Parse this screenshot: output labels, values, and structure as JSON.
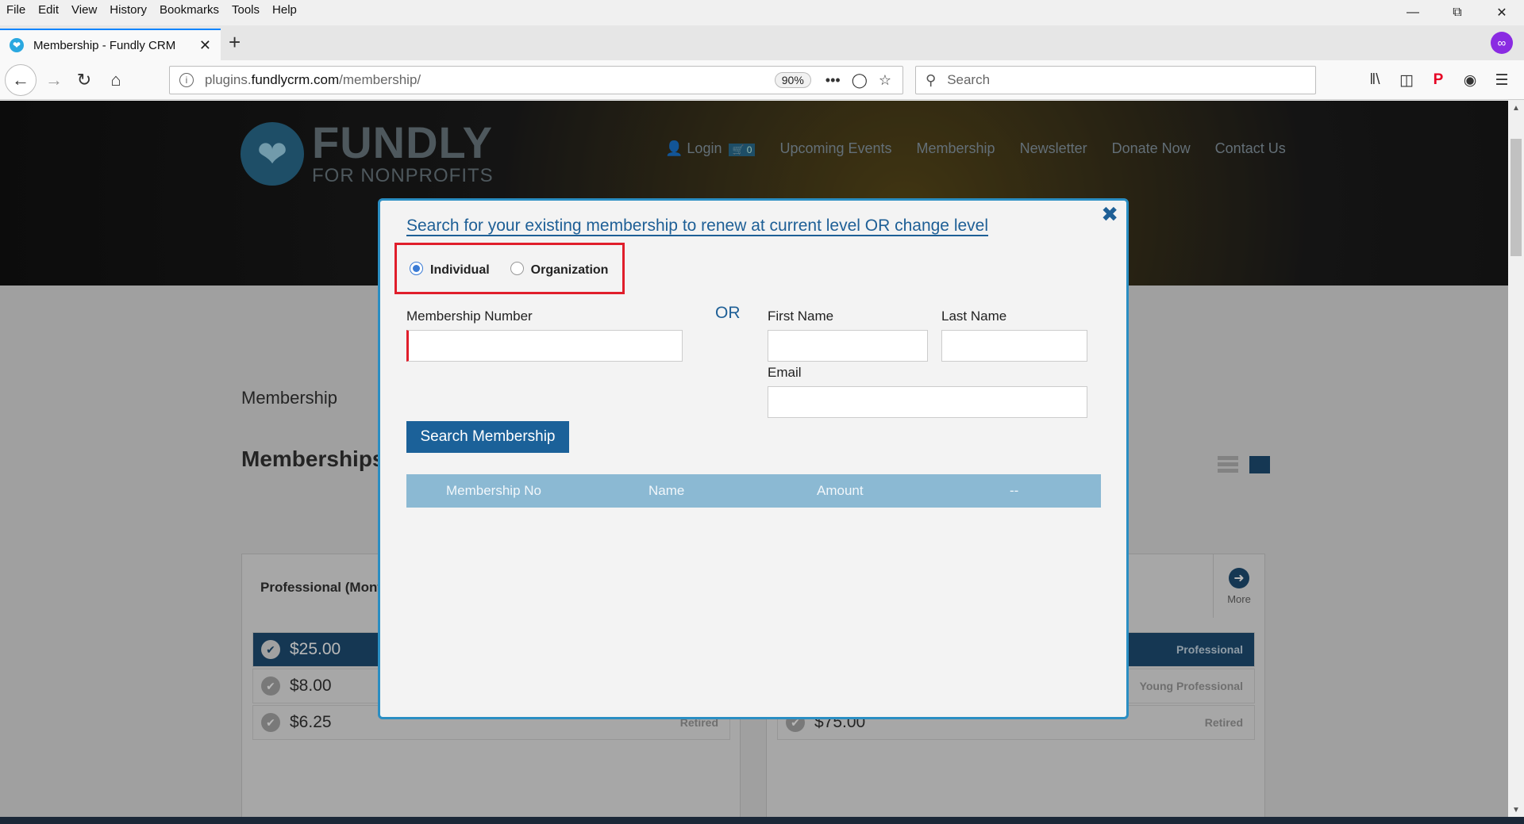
{
  "browser": {
    "menu": [
      "File",
      "Edit",
      "View",
      "History",
      "Bookmarks",
      "Tools",
      "Help"
    ],
    "tab_title": "Membership - Fundly CRM",
    "url_domain": "plugins.fundlycrm.com",
    "url_prefix": "plugins.",
    "url_host": "fundlycrm.com",
    "url_path": "/membership/",
    "zoom": "90%",
    "search_placeholder": "Search"
  },
  "site": {
    "brand": "FUNDLY",
    "tagline": "FOR NONPROFITS",
    "nav": {
      "login": "Login",
      "cart_count": "0",
      "items": [
        "Upcoming Events",
        "Membership",
        "Newsletter",
        "Donate Now",
        "Contact Us"
      ]
    },
    "page_heading": "Membership",
    "section_heading": "Memberships",
    "cards": {
      "left_title": "Professional (Mont",
      "right_more": "More",
      "left_rows": [
        {
          "amount": "$25.00",
          "level": ""
        },
        {
          "amount": "$8.00",
          "level": ""
        },
        {
          "amount": "$6.25",
          "level": "Retired"
        }
      ],
      "right_rows": [
        {
          "amount": "",
          "level": "Professional"
        },
        {
          "amount": "",
          "level": "Young Professional"
        },
        {
          "amount": "$75.00",
          "level": "Retired"
        }
      ]
    }
  },
  "modal": {
    "title": "Search for your existing membership to renew at current level OR change level",
    "radio_individual": "Individual",
    "radio_organization": "Organization",
    "membership_number_label": "Membership Number",
    "membership_number_value": "",
    "or_label": "OR",
    "first_name_label": "First Name",
    "last_name_label": "Last Name",
    "email_label": "Email",
    "search_button": "Search Membership",
    "table_headers": [
      "Membership No",
      "Name",
      "Amount",
      "--"
    ]
  },
  "colors": {
    "accent": "#1b6199",
    "modal_border": "#2a8ec3",
    "highlight_box": "#e01e2b",
    "table_header": "#8bb9d3"
  }
}
